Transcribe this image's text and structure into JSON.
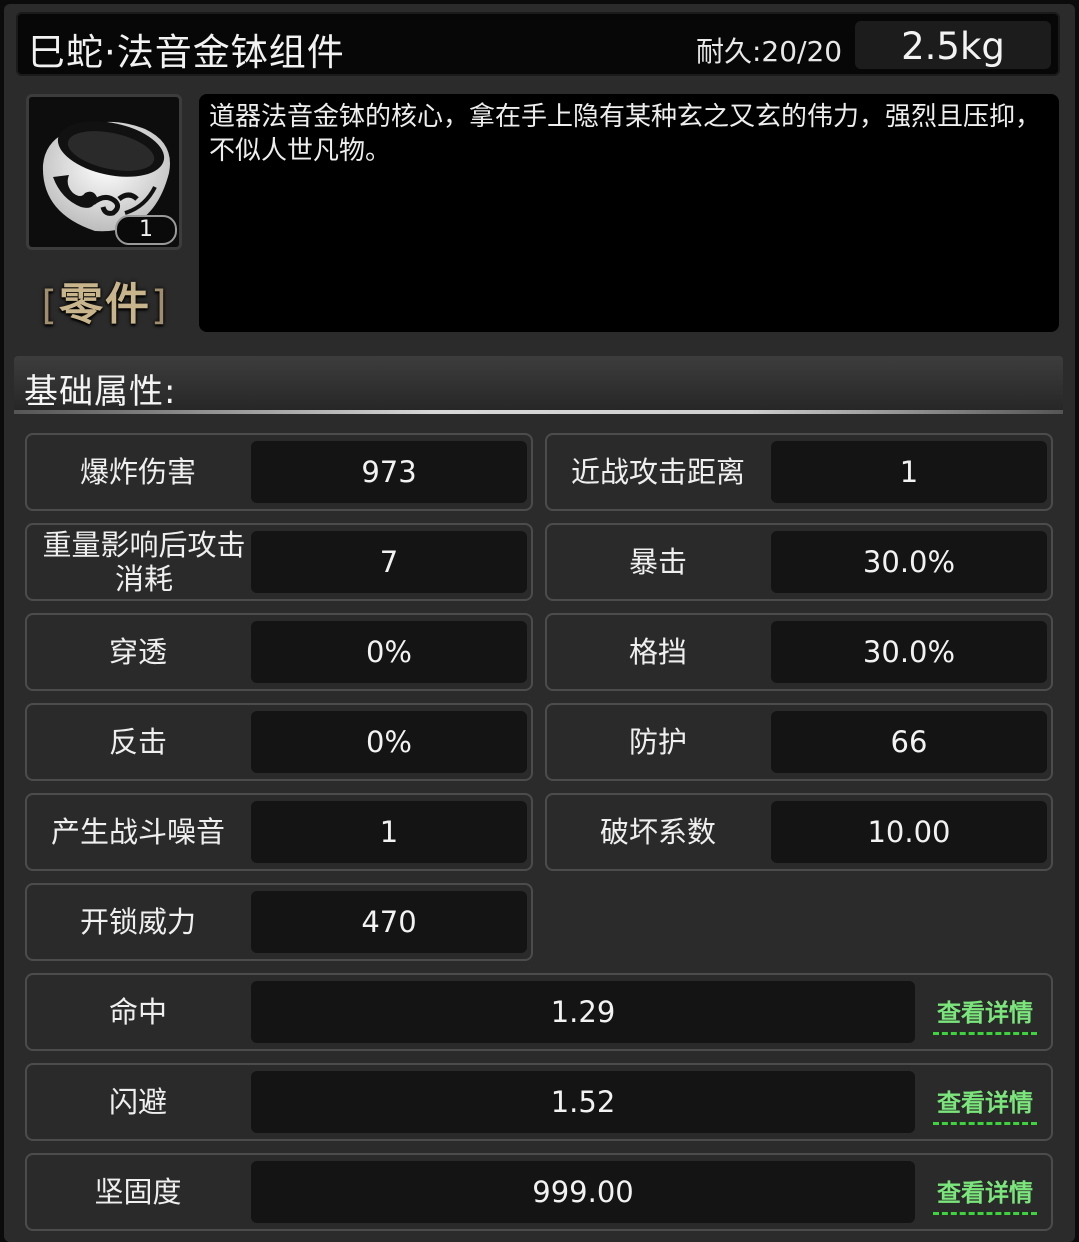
{
  "item": {
    "name": "巳蛇·法音金钵组件",
    "durability": "耐久:20/20",
    "weight": "2.5kg",
    "count": "1",
    "category": "零件",
    "category_bracket_left": "[",
    "category_bracket_right": "]",
    "icon": "bowl-icon",
    "description": "道器法音金钵的核心，拿在手上隐有某种玄之又玄的伟力，强烈且压抑，不似人世凡物。"
  },
  "section": {
    "title": "基础属性:"
  },
  "stats": [
    {
      "label": "爆炸伤害",
      "value": "973"
    },
    {
      "label": "近战攻击距离",
      "value": "1"
    },
    {
      "label": "重量影响后攻击消耗",
      "value": "7"
    },
    {
      "label": "暴击",
      "value": "30.0%"
    },
    {
      "label": "穿透",
      "value": "0%"
    },
    {
      "label": "格挡",
      "value": "30.0%"
    },
    {
      "label": "反击",
      "value": "0%"
    },
    {
      "label": "防护",
      "value": "66"
    },
    {
      "label": "产生战斗噪音",
      "value": "1"
    },
    {
      "label": "破坏系数",
      "value": "10.00"
    },
    {
      "label": "开锁威力",
      "value": "470"
    }
  ],
  "detail_stats": [
    {
      "label": "命中",
      "value": "1.29",
      "link": "查看详情"
    },
    {
      "label": "闪避",
      "value": "1.52",
      "link": "查看详情"
    },
    {
      "label": "坚固度",
      "value": "999.00",
      "link": "查看详情"
    }
  ]
}
